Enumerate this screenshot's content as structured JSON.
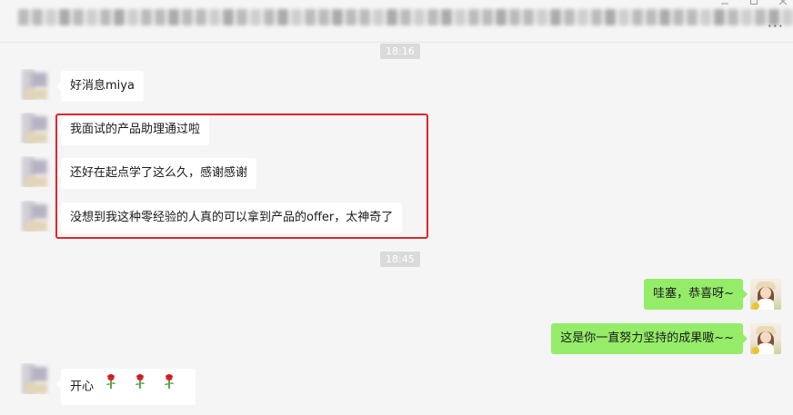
{
  "timestamps": [
    "18:16",
    "18:45"
  ],
  "messages": [
    {
      "side": "left",
      "text": "好消息miya"
    },
    {
      "side": "left",
      "text": "我面试的产品助理通过啦"
    },
    {
      "side": "left",
      "text": "还好在起点学了这么久，感谢感谢"
    },
    {
      "side": "left",
      "text": "没想到我这种零经验的人真的可以拿到产品的offer，太神奇了"
    },
    {
      "side": "right",
      "text": "哇塞，恭喜呀~"
    },
    {
      "side": "right",
      "text": "这是你一直努力坚持的成果嗷~~"
    },
    {
      "side": "left",
      "text": "开心",
      "emoji": [
        "rose-icon",
        "rose-icon",
        "rose-icon"
      ]
    }
  ],
  "colors": {
    "my_bubble": "#95ec69",
    "their_bubble": "#ffffff",
    "highlight_border": "#e2242c",
    "background": "#f5f5f5"
  },
  "icons": [
    "more-icon",
    "minimize-icon",
    "maximize-icon",
    "close-icon"
  ]
}
